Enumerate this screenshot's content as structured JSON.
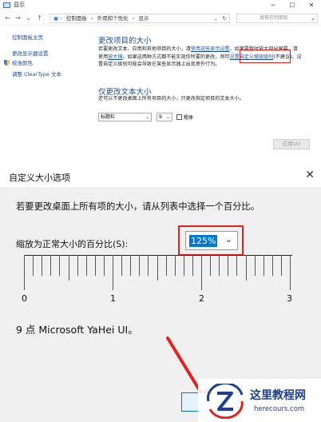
{
  "top_window": {
    "title": "显示",
    "address": [
      "控制面板",
      "外观和个性化",
      "显示"
    ],
    "search_placeholder": "搜索控制面板",
    "sidebar": [
      {
        "label": "控制面板主页"
      },
      {
        "label": "更改显示器设置"
      },
      {
        "label": "校准颜色"
      },
      {
        "label": "调整 ClearType 文本"
      }
    ],
    "section1": {
      "heading": "更改项目的大小",
      "line1_a": "若要更改文本、应用和其他项目的大小，请",
      "line1_link": "使用这些显示设置",
      "line1_b": "。如果要暂时放大部分屏幕，请",
      "line2_a": "使用",
      "line2_link1": "放大镜",
      "line2_b": "。如果这两种方式都不能实现你所要的更改，则可",
      "line2_link2": "设置自定义缩放级别",
      "line2_c": "(不建议)。设",
      "line3": "置自定义级别可能会导致在某些显示器上出现意外行为。"
    },
    "section2": {
      "heading": "仅更改文本大小",
      "desc": "还可以不更改桌面上所有项目的大小，只更改指定项目的文本大小。",
      "item_select": "标题栏",
      "size_select": "9",
      "bold_label": "粗体"
    },
    "apply_label": "应用(A)"
  },
  "dialog": {
    "title": "自定义大小选项",
    "message": "若要更改桌面上所有项的大小，请从列表中选择一个百分比。",
    "scale_label": "缩放为正常大小的百分比(S):",
    "scale_value": "125%",
    "ruler_labels": [
      "0",
      "1",
      "2",
      "3"
    ],
    "font_info": "9 点 Microsoft YaHei UI。"
  },
  "watermark": {
    "title": "这里教程网",
    "url": "herecours.com"
  },
  "colors": {
    "accent": "#0078d7",
    "link": "#1a4e9a",
    "highlight_red": "#e0231c"
  }
}
